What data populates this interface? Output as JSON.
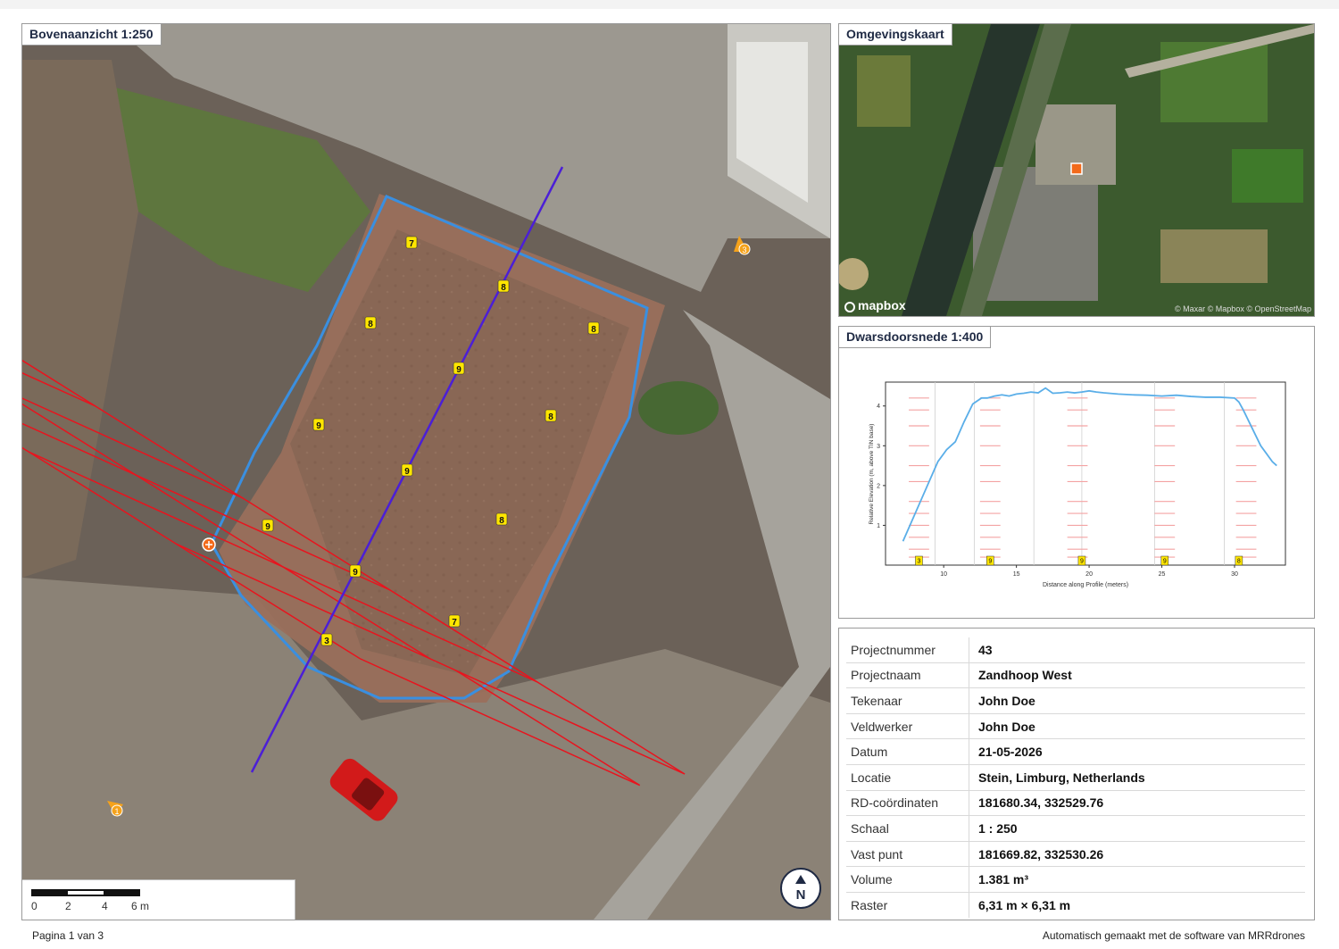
{
  "aerial": {
    "title": "Bovenaanzicht 1:250",
    "scale_labels": [
      "0",
      "2",
      "4",
      "6 m"
    ],
    "north_label": "N",
    "grid_values": [
      "7",
      "8",
      "8",
      "8",
      "9",
      "9",
      "8",
      "9",
      "9",
      "8",
      "9",
      "7",
      "3"
    ],
    "markers": [
      "3",
      "1"
    ]
  },
  "overview": {
    "title": "Omgevingskaart",
    "logo_text": "mapbox",
    "attribution": "© Maxar © Mapbox © OpenStreetMap"
  },
  "section": {
    "title": "Dwarsdoorsnede 1:400"
  },
  "chart_data": {
    "type": "line",
    "xlabel": "Distance along Profile (meters)",
    "ylabel": "Relative Elevation (m, above TIN base)",
    "xlim": [
      6,
      33.5
    ],
    "ylim": [
      0,
      4.6
    ],
    "xticks": [
      10,
      15,
      20,
      25,
      30
    ],
    "yticks": [
      1,
      2,
      3,
      4
    ],
    "series": [
      {
        "x": [
          7.2,
          7.8,
          8.4,
          9.0,
          9.6,
          10.2,
          10.8,
          11.4,
          12.0,
          12.6,
          13.0,
          13.5,
          14.0,
          14.5,
          15.0,
          15.5,
          16.0,
          16.5,
          17.0,
          17.5,
          18.0,
          18.5,
          19.0,
          19.5,
          20.0,
          20.5,
          21.0,
          22.0,
          23.0,
          24.0,
          25.0,
          26.0,
          27.0,
          28.0,
          29.0,
          30.0,
          30.3,
          30.6,
          31.0,
          31.4,
          31.8,
          32.2,
          32.6,
          32.9
        ],
        "y": [
          0.6,
          1.1,
          1.6,
          2.1,
          2.6,
          2.9,
          3.1,
          3.6,
          4.05,
          4.2,
          4.2,
          4.25,
          4.28,
          4.25,
          4.3,
          4.32,
          4.35,
          4.33,
          4.45,
          4.32,
          4.33,
          4.35,
          4.33,
          4.35,
          4.38,
          4.35,
          4.33,
          4.3,
          4.28,
          4.27,
          4.25,
          4.27,
          4.24,
          4.22,
          4.22,
          4.2,
          4.1,
          3.9,
          3.6,
          3.3,
          3.0,
          2.8,
          2.6,
          2.5
        ]
      }
    ],
    "column_labels": [
      "3",
      "9",
      "9",
      "9",
      "8"
    ]
  },
  "info": {
    "rows": [
      {
        "label": "Projectnummer",
        "value": "43"
      },
      {
        "label": "Projectnaam",
        "value": "Zandhoop West"
      },
      {
        "label": "Tekenaar",
        "value": "John Doe"
      },
      {
        "label": "Veldwerker",
        "value": "John Doe"
      },
      {
        "label": "Datum",
        "value": "21-05-2026"
      },
      {
        "label": "Locatie",
        "value": "Stein, Limburg, Netherlands"
      },
      {
        "label": "RD-coördinaten",
        "value": "181680.34, 332529.76"
      },
      {
        "label": "Schaal",
        "value": "1 : 250"
      },
      {
        "label": "Vast punt",
        "value": "181669.82, 332530.26"
      },
      {
        "label": "Volume",
        "value": "1.381 m³"
      },
      {
        "label": "Raster",
        "value": "6,31 m × 6,31 m"
      }
    ]
  },
  "footer": {
    "page": "Pagina 1 van 3",
    "credit": "Automatisch gemaakt met de software van MRRdrones"
  },
  "colors": {
    "grid": "#e8141e",
    "boundary": "#3a8fe0",
    "profile_line": "#4b1fd6",
    "label_bg": "#ffe600",
    "site_marker": "#f26a1b",
    "curve": "#5aaee8"
  }
}
